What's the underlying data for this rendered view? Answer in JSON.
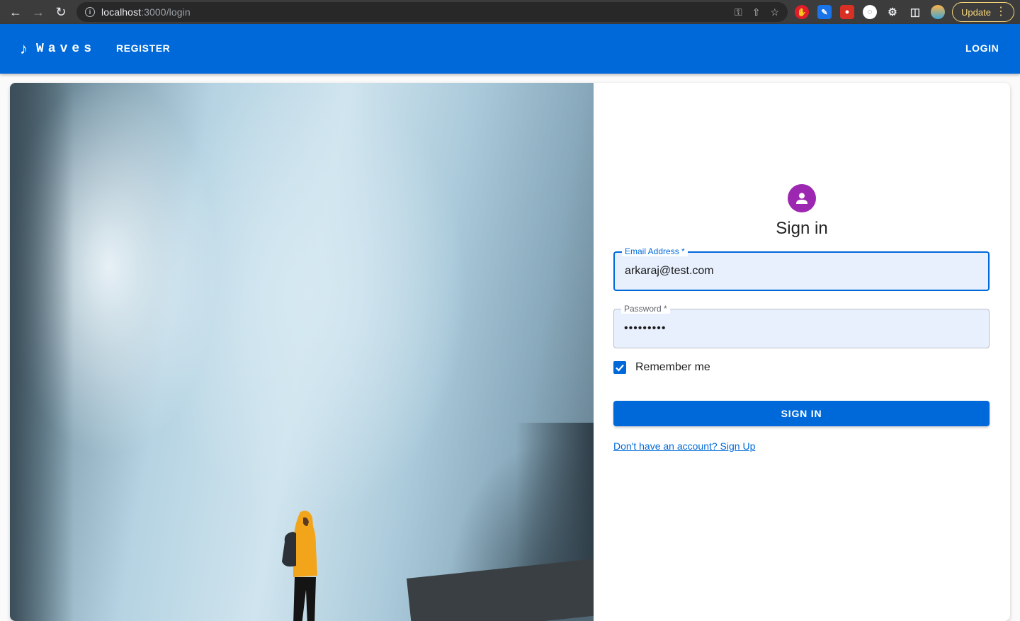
{
  "browser": {
    "url_host": "localhost",
    "url_path": ":3000/login",
    "update_label": "Update"
  },
  "appbar": {
    "brand": "Waves",
    "register_label": "REGISTER",
    "login_label": "LOGIN",
    "color": "#0069d9"
  },
  "form": {
    "title": "Sign in",
    "email": {
      "label": "Email Address *",
      "value": "arkaraj@test.com"
    },
    "password": {
      "label": "Password *",
      "value": "•••••••••"
    },
    "remember_label": "Remember me",
    "remember_checked": true,
    "signin_label": "SIGN IN",
    "signup_link": "Don't have an account? Sign Up",
    "avatar_color": "#9c27b0"
  }
}
